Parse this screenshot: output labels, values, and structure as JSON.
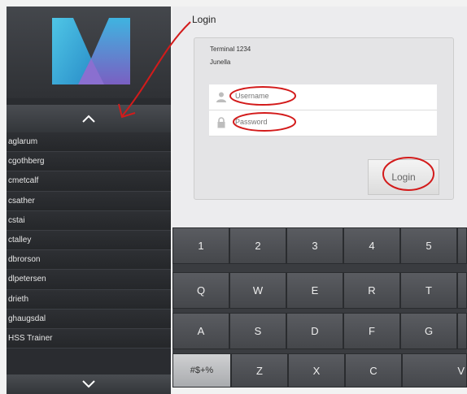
{
  "sidebar": {
    "users": [
      "aglarum",
      "cgothberg",
      "cmetcalf",
      "csather",
      "cstai",
      "ctalley",
      "dbrorson",
      "dlpetersen",
      "drieth",
      "ghaugsdal",
      "HSS Trainer"
    ]
  },
  "login": {
    "caption": "Login",
    "terminal": "Terminal 1234",
    "user": "Junella",
    "username_placeholder": "Username",
    "password_placeholder": "Password",
    "button": "Login"
  },
  "keyboard": {
    "row1": [
      "1",
      "2",
      "3",
      "4",
      "5"
    ],
    "row2": [
      "Q",
      "W",
      "E",
      "R",
      "T"
    ],
    "row3": [
      "A",
      "S",
      "D",
      "F",
      "G"
    ],
    "row4": [
      "#$+%",
      "Z",
      "X",
      "C",
      "V"
    ]
  },
  "colors": {
    "annotation": "#d31b1b",
    "sidebar_bg": "#2a2c30"
  },
  "icons": {
    "up": "chevron-up-icon",
    "down": "chevron-down-icon",
    "user": "user-icon",
    "lock": "lock-icon",
    "logo": "m-logo"
  }
}
